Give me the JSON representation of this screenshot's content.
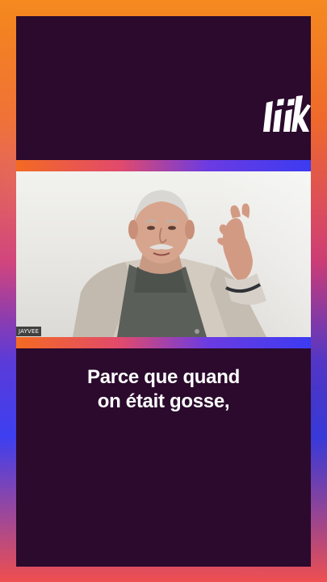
{
  "brand": {
    "logo_text": "liiK",
    "logo_icon": "liik-logo-icon"
  },
  "video": {
    "participant_name": "JAYVEE",
    "subject": "man-speaking-illustration"
  },
  "caption": {
    "line1": "Parce que quand",
    "line2": "on était gosse,"
  },
  "colors": {
    "panel": "#2b0a2d",
    "frame_orange": "#f58a1f",
    "frame_purple": "#5b3bd8",
    "frame_blue": "#3d3ff0",
    "caption_text": "#ffffff"
  }
}
